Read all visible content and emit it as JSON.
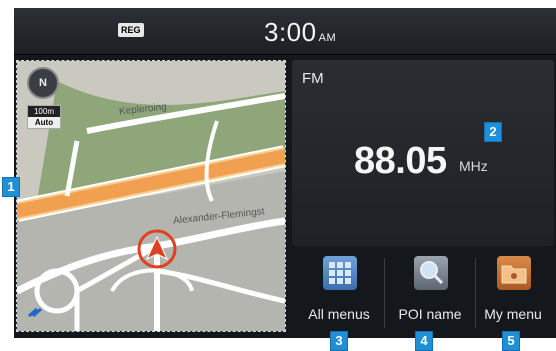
{
  "status_bar": {
    "reg_badge": "REG",
    "time": "3:00",
    "ampm": "AM"
  },
  "map": {
    "compass": "N",
    "scale": "100m",
    "scale_mode": "Auto",
    "streets": [
      "Kepleroing",
      "Alexander-Flemingst"
    ]
  },
  "radio": {
    "band": "FM",
    "frequency": "88.05",
    "unit": "MHz"
  },
  "buttons": [
    {
      "label": "All menus",
      "icon": "grid-icon"
    },
    {
      "label": "POI name",
      "icon": "magnifier-icon"
    },
    {
      "label": "My menu",
      "icon": "folder-icon"
    }
  ],
  "callouts": [
    "1",
    "2",
    "3",
    "4",
    "5"
  ],
  "colors": {
    "callout": "#1f8fd8",
    "highway": "#f0a050",
    "screen_bg": "#14171c",
    "position_marker": "#e04020"
  }
}
